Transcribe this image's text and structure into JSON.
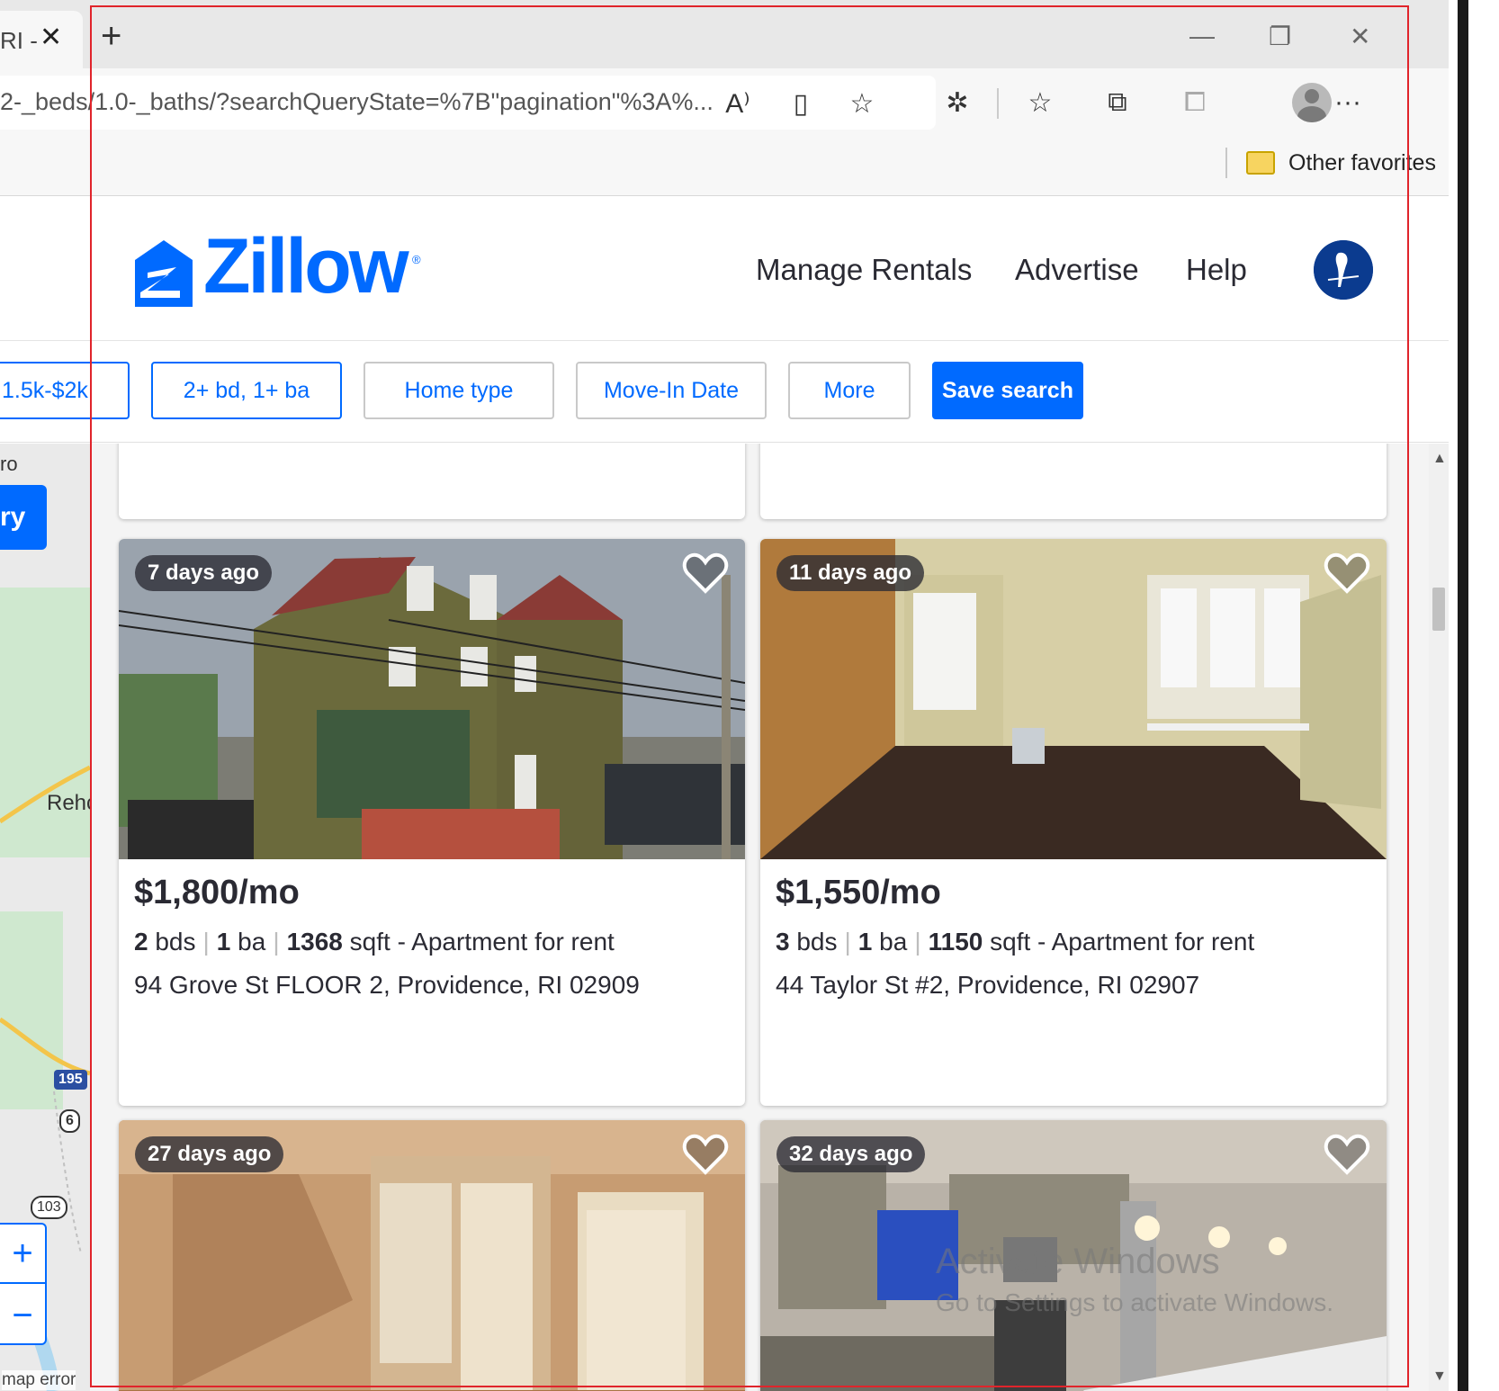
{
  "browser": {
    "tab_title": "RI -",
    "address_url": "2-_beds/1.0-_baths/?searchQueryState=%7B\"pagination\"%3A%...",
    "favorites_label": "Other favorites"
  },
  "header": {
    "logo_text": "Zillow",
    "logo_reg": "®",
    "nav": [
      "Manage Rentals",
      "Advertise",
      "Help"
    ]
  },
  "filters": {
    "price": "1.5k-$2k",
    "beds_baths": "2+ bd, 1+ ba",
    "home_type": "Home type",
    "move_in": "Move-In Date",
    "more": "More",
    "save": "Save search"
  },
  "map": {
    "label_top": "ro",
    "button_label": "ry",
    "label_town": "Rehc",
    "shield_195": "195",
    "shield_6": "6",
    "shield_103": "103",
    "zoom_in": "+",
    "zoom_out": "−",
    "error": "map error"
  },
  "listings": [
    {
      "badge": "7 days ago",
      "price": "$1,800/mo",
      "beds": "2",
      "beds_unit": "bds",
      "baths": "1",
      "baths_unit": "ba",
      "sqft": "1368",
      "sqft_unit": "sqft - Apartment for rent",
      "address": "94 Grove St FLOOR 2, Providence, RI 02909"
    },
    {
      "badge": "11 days ago",
      "price": "$1,550/mo",
      "beds": "3",
      "beds_unit": "bds",
      "baths": "1",
      "baths_unit": "ba",
      "sqft": "1150",
      "sqft_unit": "sqft - Apartment for rent",
      "address": "44 Taylor St #2, Providence, RI 02907"
    },
    {
      "badge": "27 days ago"
    },
    {
      "badge": "32 days ago"
    }
  ],
  "watermark": {
    "line1": "Activate Windows",
    "line2": "Go to Settings to activate Windows."
  },
  "colors": {
    "zillow_blue": "#006aff",
    "text_dark": "#2a2a33"
  }
}
